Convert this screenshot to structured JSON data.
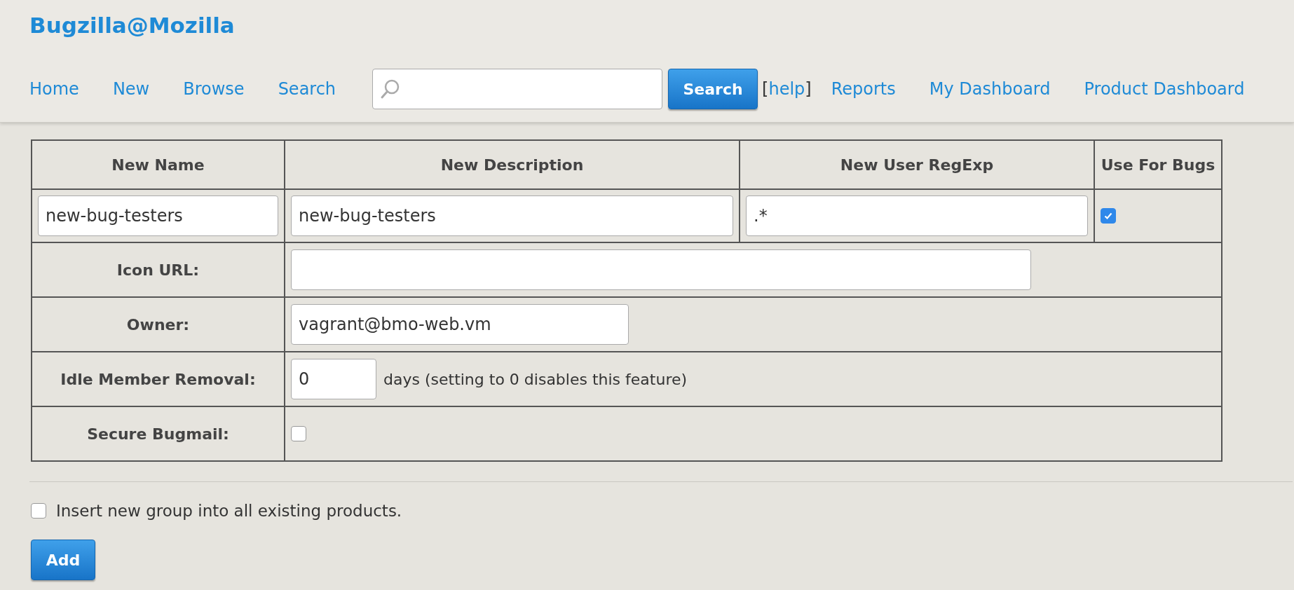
{
  "site_title": "Bugzilla@Mozilla",
  "nav": {
    "links_left": [
      "Home",
      "New",
      "Browse",
      "Search"
    ],
    "search_button": "Search",
    "help": {
      "open": "[",
      "label": "help",
      "close": "]"
    },
    "links_right": [
      "Reports",
      "My Dashboard",
      "Product Dashboard"
    ]
  },
  "table": {
    "columns": [
      "New Name",
      "New Description",
      "New User RegExp",
      "Use For Bugs"
    ],
    "new_row": {
      "name": "new-bug-testers",
      "description": "new-bug-testers",
      "regexp": ".*",
      "use_for_bugs": {
        "checked": true
      }
    },
    "fields": [
      {
        "kind": "url",
        "label": "Icon URL:"
      },
      {
        "kind": "text",
        "label": "Owner:",
        "value": "vagrant@bmo-web.vm"
      },
      {
        "kind": "days",
        "label": "Idle Member Removal:",
        "value": "0",
        "note": "days (setting to 0 disables this feature)"
      },
      {
        "kind": "checkbox",
        "label": "Secure Bugmail:",
        "checked": false
      }
    ]
  },
  "insert_option": {
    "label": "Insert new group into all existing products.",
    "checked": false
  },
  "add_button": "Add"
}
